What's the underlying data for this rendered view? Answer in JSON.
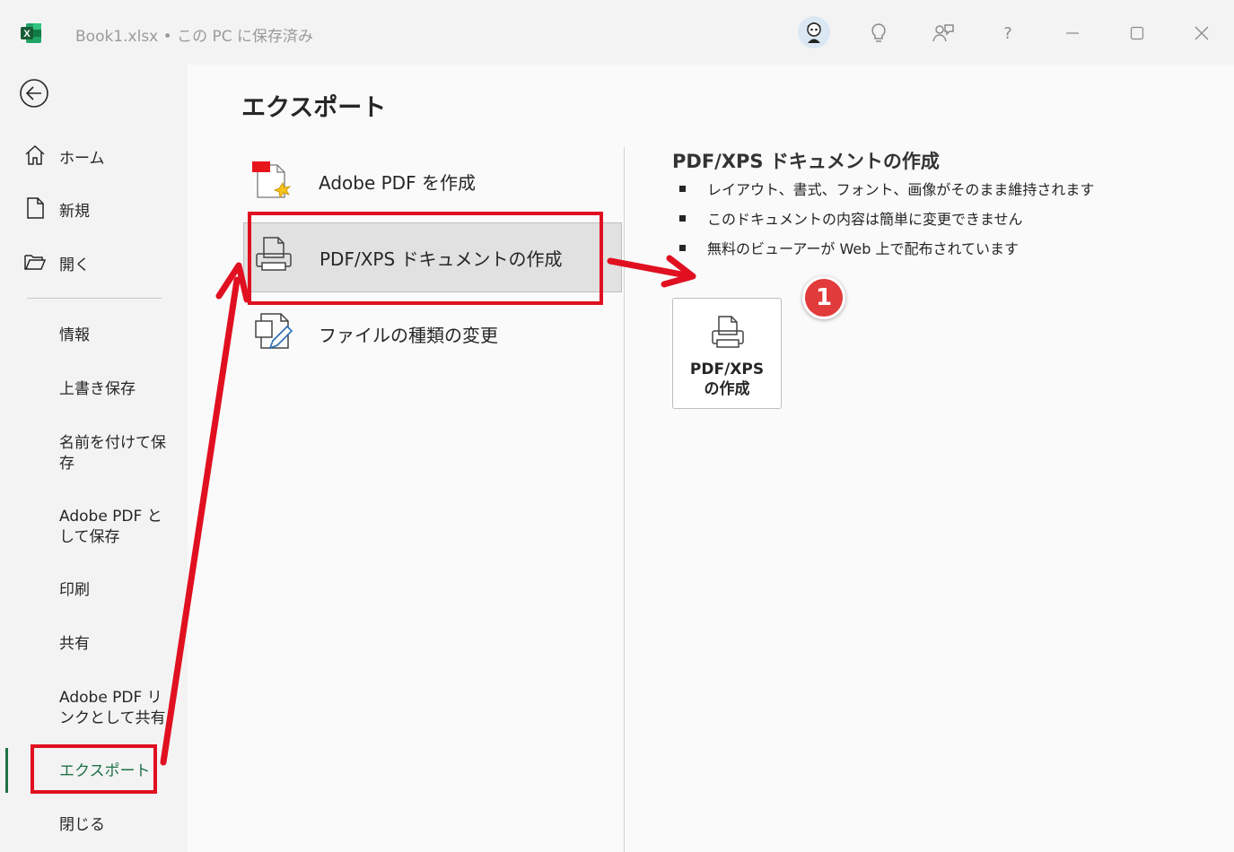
{
  "titlebar": {
    "app_icon_letter": "X",
    "file_name": "Book1.xlsx",
    "separator": "•",
    "save_status": "この PC に保存済み",
    "icons": [
      "avatar",
      "lightbulb-icon",
      "coauthor-icon",
      "help-icon",
      "minimize-icon",
      "maximize-icon",
      "close-icon"
    ],
    "help_glyph": "?"
  },
  "nav": {
    "back_icon": "back-arrow-icon",
    "main_items": [
      {
        "label": "ホーム",
        "icon": "home-icon"
      },
      {
        "label": "新規",
        "icon": "new-document-icon"
      },
      {
        "label": "開く",
        "icon": "open-folder-icon"
      }
    ],
    "sub_items": [
      {
        "label": "情報"
      },
      {
        "label": "上書き保存"
      },
      {
        "label": "名前を付けて保存"
      },
      {
        "label": "Adobe PDF として保存"
      },
      {
        "label": "印刷"
      },
      {
        "label": "共有"
      },
      {
        "label": "Adobe PDF リンクとして共有"
      },
      {
        "label": "エクスポート"
      },
      {
        "label": "閉じる"
      }
    ],
    "active": "エクスポート"
  },
  "main": {
    "title": "エクスポート",
    "options": [
      {
        "label": "Adobe PDF を作成",
        "icon": "adobe-pdf-icon"
      },
      {
        "label": "PDF/XPS ドキュメントの作成",
        "icon": "printer-document-icon"
      },
      {
        "label": "ファイルの種類の変更",
        "icon": "change-file-type-icon"
      }
    ],
    "selected_option": "PDF/XPS ドキュメントの作成",
    "detail": {
      "title": "PDF/XPS ドキュメントの作成",
      "bullets": [
        "レイアウト、書式、フォント、画像がそのまま維持されます",
        "このドキュメントの内容は簡単に変更できません",
        "無料のビューアーが Web 上で配布されています"
      ],
      "button_line1": "PDF/XPS",
      "button_line2": "の作成"
    }
  },
  "annotation": {
    "badge_number": "1",
    "color": "#e01020"
  },
  "colors": {
    "excel_green": "#1e7145",
    "annotation_red": "#e01020"
  }
}
